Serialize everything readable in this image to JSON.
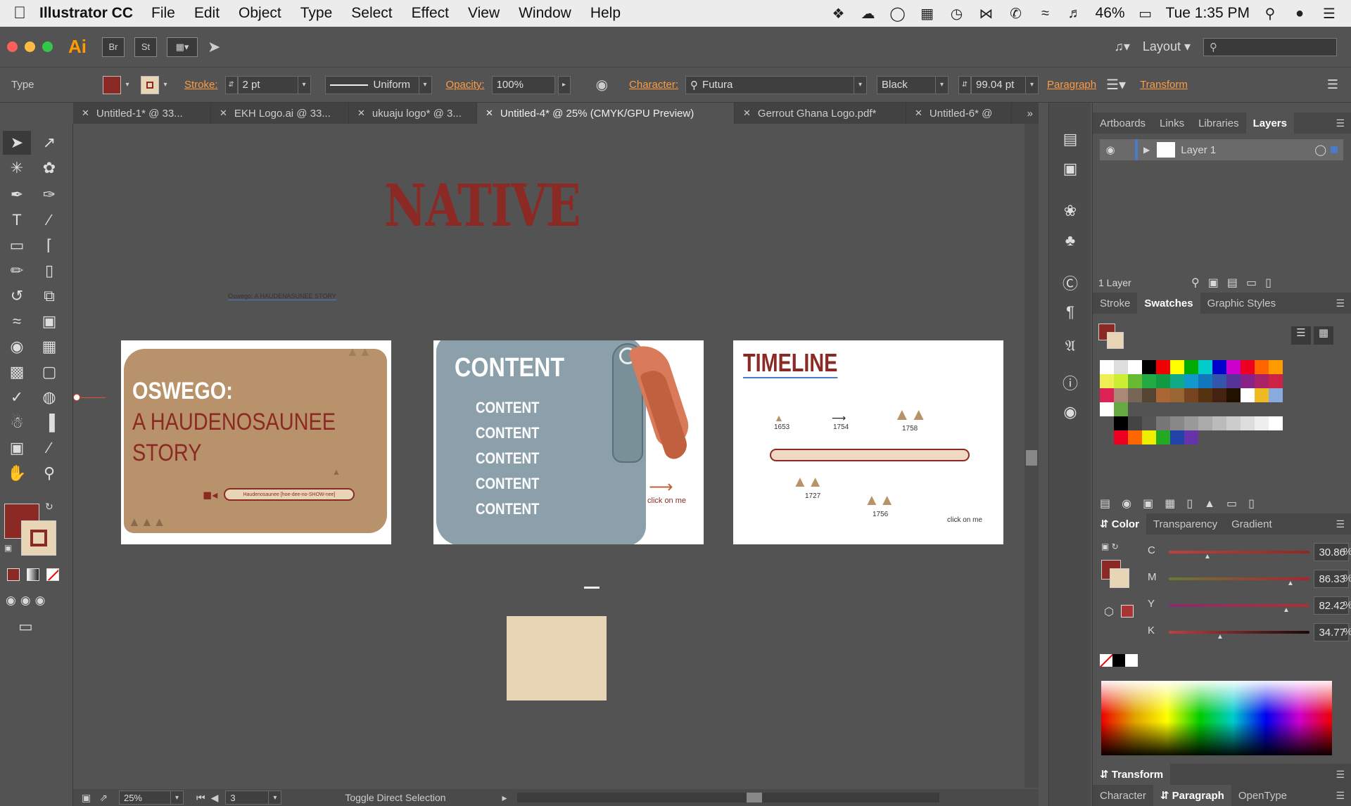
{
  "menubar": {
    "app_name": "Illustrator CC",
    "items": [
      "File",
      "Edit",
      "Object",
      "Type",
      "Select",
      "Effect",
      "View",
      "Window",
      "Help"
    ],
    "battery": "46%",
    "clock": "Tue 1:35 PM"
  },
  "appbar": {
    "logo": "Ai",
    "bridge": "Br",
    "stock": "St",
    "workspace": "Layout"
  },
  "control": {
    "tool_name": "Type",
    "stroke_label": "Stroke:",
    "stroke_value": "2 pt",
    "profile": "Uniform",
    "opacity_label": "Opacity:",
    "opacity_value": "100%",
    "character_label": "Character:",
    "font_family": "Futura",
    "font_style": "Black",
    "font_size": "99.04 pt",
    "paragraph_label": "Paragraph",
    "transform_label": "Transform",
    "fill_color": "#8b2a24"
  },
  "tabs": [
    {
      "label": "Untitled-1* @ 33...",
      "active": false
    },
    {
      "label": "EKH Logo.ai @ 33...",
      "active": false
    },
    {
      "label": "ukuaju logo* @ 3...",
      "active": false
    },
    {
      "label": "Untitled-4* @ 25% (CMYK/GPU Preview)",
      "active": true
    },
    {
      "label": "Gerrout Ghana Logo.pdf*",
      "active": false
    },
    {
      "label": "Untitled-6* @",
      "active": false
    }
  ],
  "canvas": {
    "native_title": "NATIVE",
    "subtitle_small": "Oswego: A HAUDENASUNEE STORY",
    "board1": {
      "line1": "OSWEGO:",
      "line2": "A HAUDENOSAUNEE",
      "line3": "STORY",
      "pronunciation": "Haudenosaunee [hoe-dee-no-SHOW-nee]"
    },
    "board2": {
      "heading": "CONTENT",
      "items": [
        "CONTENT",
        "CONTENT",
        "CONTENT",
        "CONTENT",
        "CONTENT"
      ],
      "click": "click on me"
    },
    "board3": {
      "heading": "TIMELINE",
      "years": [
        "1653",
        "1754",
        "1758",
        "1727",
        "1756"
      ],
      "click": "click on me"
    }
  },
  "panels": {
    "top_tabs": [
      "Artboards",
      "Links",
      "Libraries",
      "Layers"
    ],
    "layer_name": "Layer 1",
    "layer_count": "1 Layer",
    "mid_tabs": [
      "Stroke",
      "Swatches",
      "Graphic Styles"
    ],
    "color_tabs": [
      "Color",
      "Transparency",
      "Gradient"
    ],
    "cmyk": [
      {
        "label": "C",
        "value": "30.86"
      },
      {
        "label": "M",
        "value": "86.33"
      },
      {
        "label": "Y",
        "value": "82.42"
      },
      {
        "label": "K",
        "value": "34.77"
      }
    ],
    "percent": "%",
    "transform_tab": "Transform",
    "bottom_tabs": [
      "Character",
      "Paragraph",
      "OpenType"
    ]
  },
  "status": {
    "zoom": "25%",
    "page": "3",
    "message": "Toggle Direct Selection"
  }
}
